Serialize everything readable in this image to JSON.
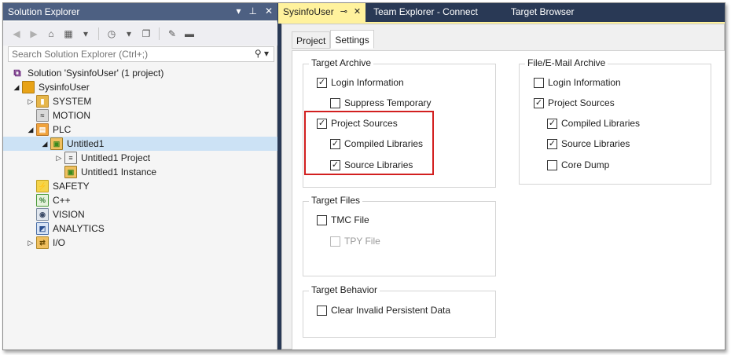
{
  "solution_explorer": {
    "title": "Solution Explorer",
    "search_placeholder": "Search Solution Explorer (Ctrl+;)",
    "tree": [
      {
        "label": "Solution 'SysinfoUser' (1 project)",
        "icon": "solution-icon"
      },
      {
        "label": "SysinfoUser",
        "icon": "project-icon"
      },
      {
        "label": "SYSTEM",
        "icon": "system-icon"
      },
      {
        "label": "MOTION",
        "icon": "motion-icon"
      },
      {
        "label": "PLC",
        "icon": "plc-icon"
      },
      {
        "label": "Untitled1",
        "icon": "plc-project-icon"
      },
      {
        "label": "Untitled1 Project",
        "icon": "document-icon"
      },
      {
        "label": "Untitled1 Instance",
        "icon": "instance-icon"
      },
      {
        "label": "SAFETY",
        "icon": "safety-icon"
      },
      {
        "label": "C++",
        "icon": "cpp-icon"
      },
      {
        "label": "VISION",
        "icon": "vision-icon"
      },
      {
        "label": "ANALYTICS",
        "icon": "analytics-icon"
      },
      {
        "label": "I/O",
        "icon": "io-icon"
      }
    ]
  },
  "doc_tabs": [
    {
      "label": "SysinfoUser",
      "active": true
    },
    {
      "label": "Team Explorer - Connect",
      "active": false
    },
    {
      "label": "Target Browser",
      "active": false
    }
  ],
  "inner_tabs": [
    {
      "label": "Project",
      "active": false
    },
    {
      "label": "Settings",
      "active": true
    }
  ],
  "target_archive": {
    "title": "Target Archive",
    "items": [
      {
        "label": "Login Information",
        "checked": true
      },
      {
        "label": "Suppress Temporary",
        "checked": false
      },
      {
        "label": "Project Sources",
        "checked": true
      },
      {
        "label": "Compiled Libraries",
        "checked": true
      },
      {
        "label": "Source Libraries",
        "checked": true
      }
    ]
  },
  "target_files": {
    "title": "Target Files",
    "items": [
      {
        "label": "TMC File",
        "checked": false,
        "enabled": true
      },
      {
        "label": "TPY File",
        "checked": false,
        "enabled": false
      }
    ]
  },
  "target_behavior": {
    "title": "Target Behavior",
    "items": [
      {
        "label": "Clear Invalid Persistent Data",
        "checked": false
      }
    ]
  },
  "email_archive": {
    "title": "File/E-Mail Archive",
    "items": [
      {
        "label": "Login Information",
        "checked": false
      },
      {
        "label": "Project Sources",
        "checked": true
      },
      {
        "label": "Compiled Libraries",
        "checked": true
      },
      {
        "label": "Source Libraries",
        "checked": true
      },
      {
        "label": "Core Dump",
        "checked": false
      }
    ]
  },
  "colors": {
    "active_tab": "#fff29d",
    "title_bar": "#4d6082",
    "highlight_border": "#d21f1f",
    "selection": "#cce2f5"
  }
}
